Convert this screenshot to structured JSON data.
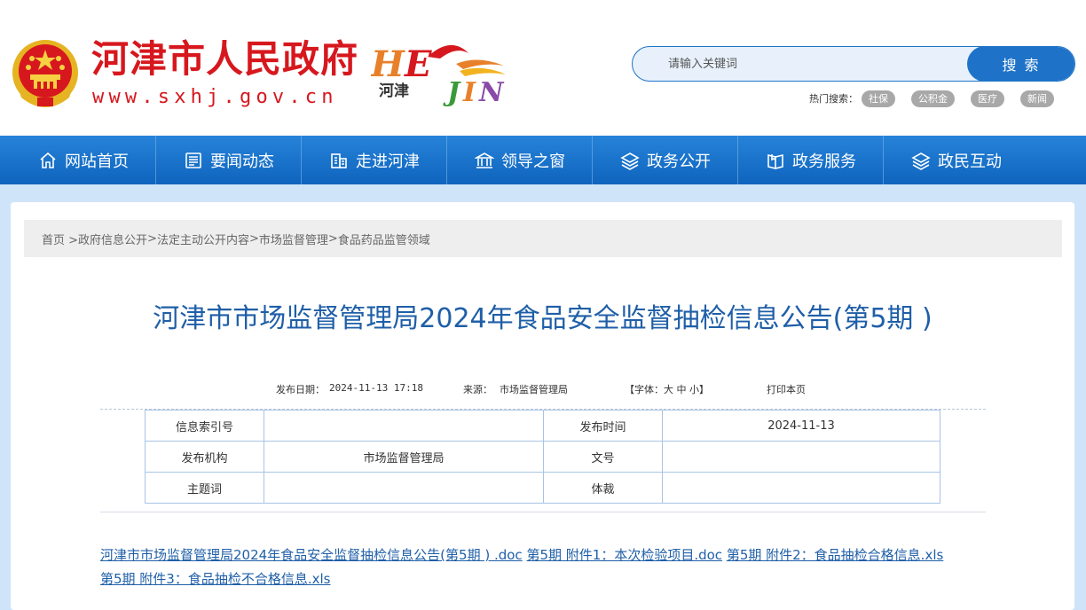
{
  "header": {
    "site_title": "河津市人民政府",
    "site_url": "www.sxhj.gov.cn",
    "logo_text": "HEJIN",
    "logo_cn": "河津",
    "search_placeholder": "请输入关键词",
    "search_button": "搜 索",
    "hot_label": "热门搜索：",
    "hot_tags": [
      "社保",
      "公积金",
      "医疗",
      "新闻"
    ]
  },
  "nav": {
    "items": [
      {
        "label": "网站首页",
        "icon": "home-icon"
      },
      {
        "label": "要闻动态",
        "icon": "news-icon"
      },
      {
        "label": "走进河津",
        "icon": "building-icon"
      },
      {
        "label": "领导之窗",
        "icon": "government-icon"
      },
      {
        "label": "政务公开",
        "icon": "layers-icon"
      },
      {
        "label": "政务服务",
        "icon": "book-icon"
      },
      {
        "label": "政民互动",
        "icon": "stack-icon"
      }
    ]
  },
  "breadcrumb": {
    "items": [
      "首页 > ",
      "政府信息公开",
      ">",
      "法定主动公开内容",
      ">",
      "市场监督管理",
      ">",
      "食品药品监管领域"
    ]
  },
  "article": {
    "title": "河津市市场监督管理局2024年食品安全监督抽检信息公告(第5期 )",
    "meta": {
      "date_label": "发布日期：",
      "date_value": "2024-11-13 17:18",
      "source_label": "来源：",
      "source_value": "市场监督管理局",
      "font_size_label": "【字体：大 中 小】",
      "print_label": "打印本页"
    },
    "info_table": {
      "index_label": "信息索引号",
      "index_value": "",
      "publish_time_label": "发布时间",
      "publish_time_value": "2024-11-13",
      "agency_label": "发布机构",
      "agency_value": "市场监督管理局",
      "doc_no_label": "文号",
      "doc_no_value": "",
      "subject_label": "主题词",
      "subject_value": "",
      "genre_label": "体裁",
      "genre_value": ""
    },
    "attachments": [
      "河津市市场监督管理局2024年食品安全监督抽检信息公告(第5期 ) .doc",
      "第5期 附件1：本次检验项目.doc",
      "第5期 附件2：食品抽检合格信息.xls",
      "第5期 附件3：食品抽检不合格信息.xls"
    ]
  },
  "colors": {
    "brand_red": "#d6181e",
    "nav_blue": "#1e73c8",
    "title_blue": "#1f5fa8"
  }
}
